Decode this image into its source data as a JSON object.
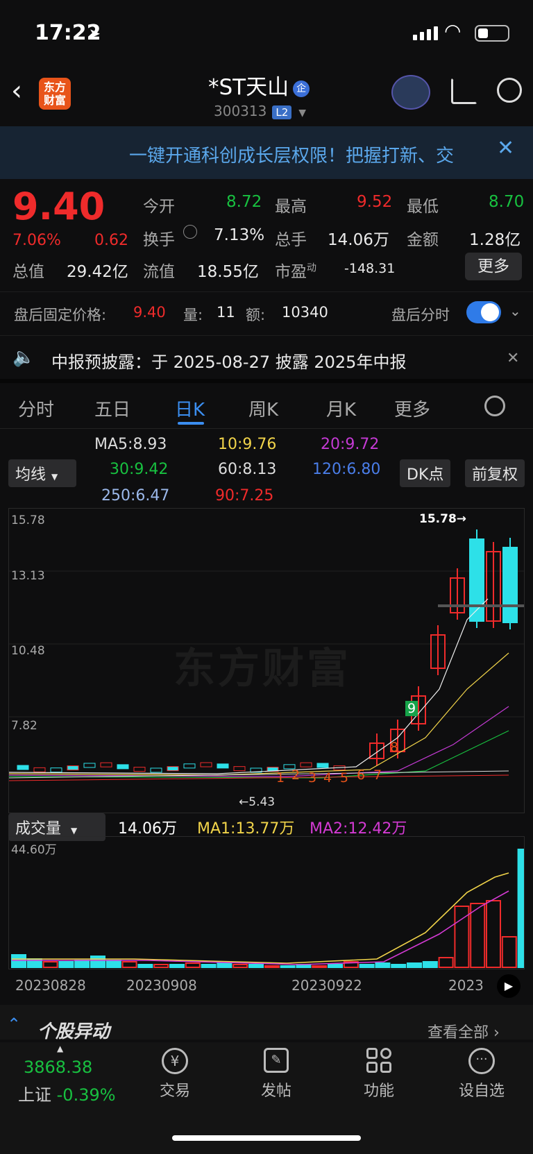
{
  "status": {
    "time": "17:22"
  },
  "header": {
    "logo": "东方\n财富",
    "title": "*ST天山",
    "badge": "企",
    "code": "300313",
    "level": "L2"
  },
  "banner": {
    "text": "一键开通科创成长层权限！把握打新、交"
  },
  "quote": {
    "price": "9.40",
    "pct": "7.06%",
    "chg": "0.62",
    "open_label": "今开",
    "open": "8.72",
    "high_label": "最高",
    "high": "9.52",
    "low_label": "最低",
    "low": "8.70",
    "turnover_label": "换手",
    "turnover": "7.13%",
    "volume_label": "总手",
    "volume": "14.06万",
    "amount_label": "金额",
    "amount": "1.28亿",
    "mcap_label": "总值",
    "mcap": "29.42亿",
    "float_label": "流值",
    "float": "18.55亿",
    "pe_label": "市盈",
    "pe_sup": "动",
    "pe": "-148.31",
    "more": "更多"
  },
  "after_hours": {
    "label": "盘后固定价格:",
    "price": "9.40",
    "vol_label": "量:",
    "vol": "11",
    "amt_label": "额:",
    "amt": "10340",
    "toggle_label": "盘后分时"
  },
  "notice": {
    "text": "中报预披露：于 2025-08-27 披露 2025年中报"
  },
  "tabs": [
    "分时",
    "五日",
    "日K",
    "周K",
    "月K",
    "更多"
  ],
  "ma": {
    "selector": "均线",
    "ma5": "MA5:8.93",
    "ma10": "10:9.76",
    "ma20": "20:9.72",
    "ma30": "30:9.42",
    "ma60": "60:8.13",
    "ma120": "120:6.80",
    "ma250": "250:6.47",
    "ma90": "90:7.25",
    "dk": "DK点",
    "fq": "前复权"
  },
  "chart_data": {
    "type": "candlestick",
    "y_ticks": [
      "15.78",
      "13.13",
      "10.48",
      "7.82"
    ],
    "annotations": {
      "high_label": "15.78",
      "low_label": "5.43",
      "watermark": "东方财富"
    },
    "signal_counts": [
      "1",
      "2",
      "3",
      "4",
      "5",
      "6",
      "7",
      "8",
      "9"
    ],
    "x_labels": [
      "20230828",
      "20230908",
      "20230922",
      "2023"
    ],
    "volume": {
      "selector": "成交量",
      "vol": "14.06万",
      "ma1": "MA1:13.77万",
      "ma2": "MA2:12.42万",
      "max": "44.60万"
    }
  },
  "alert": {
    "title": "个股异动",
    "link": "查看全部"
  },
  "bottom": {
    "index_value": "3868.38",
    "index_name": "上证",
    "index_pct": "-0.39%",
    "nav": [
      "交易",
      "发帖",
      "功能",
      "设自选"
    ]
  }
}
